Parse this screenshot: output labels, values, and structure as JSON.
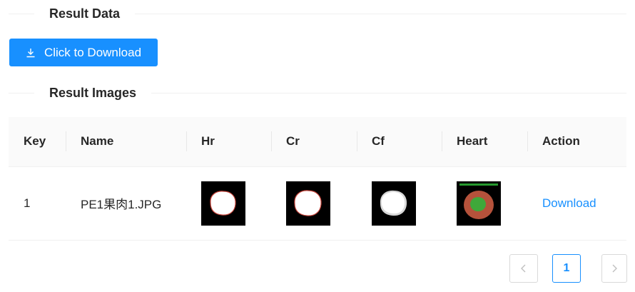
{
  "sections": {
    "result_data_title": "Result Data",
    "result_images_title": "Result Images"
  },
  "download_button": {
    "label": "Click to Download",
    "icon": "download-icon"
  },
  "table": {
    "columns": [
      "Key",
      "Name",
      "Hr",
      "Cr",
      "Cf",
      "Heart",
      "Action"
    ],
    "rows": [
      {
        "key": "1",
        "name": "PE1果肉1.JPG",
        "action": "Download"
      }
    ]
  },
  "pagination": {
    "current": "1",
    "prev_icon": "chevron-left-icon",
    "next_icon": "chevron-right-icon"
  },
  "colors": {
    "primary": "#1890ff",
    "header_bg": "#fafafa"
  }
}
